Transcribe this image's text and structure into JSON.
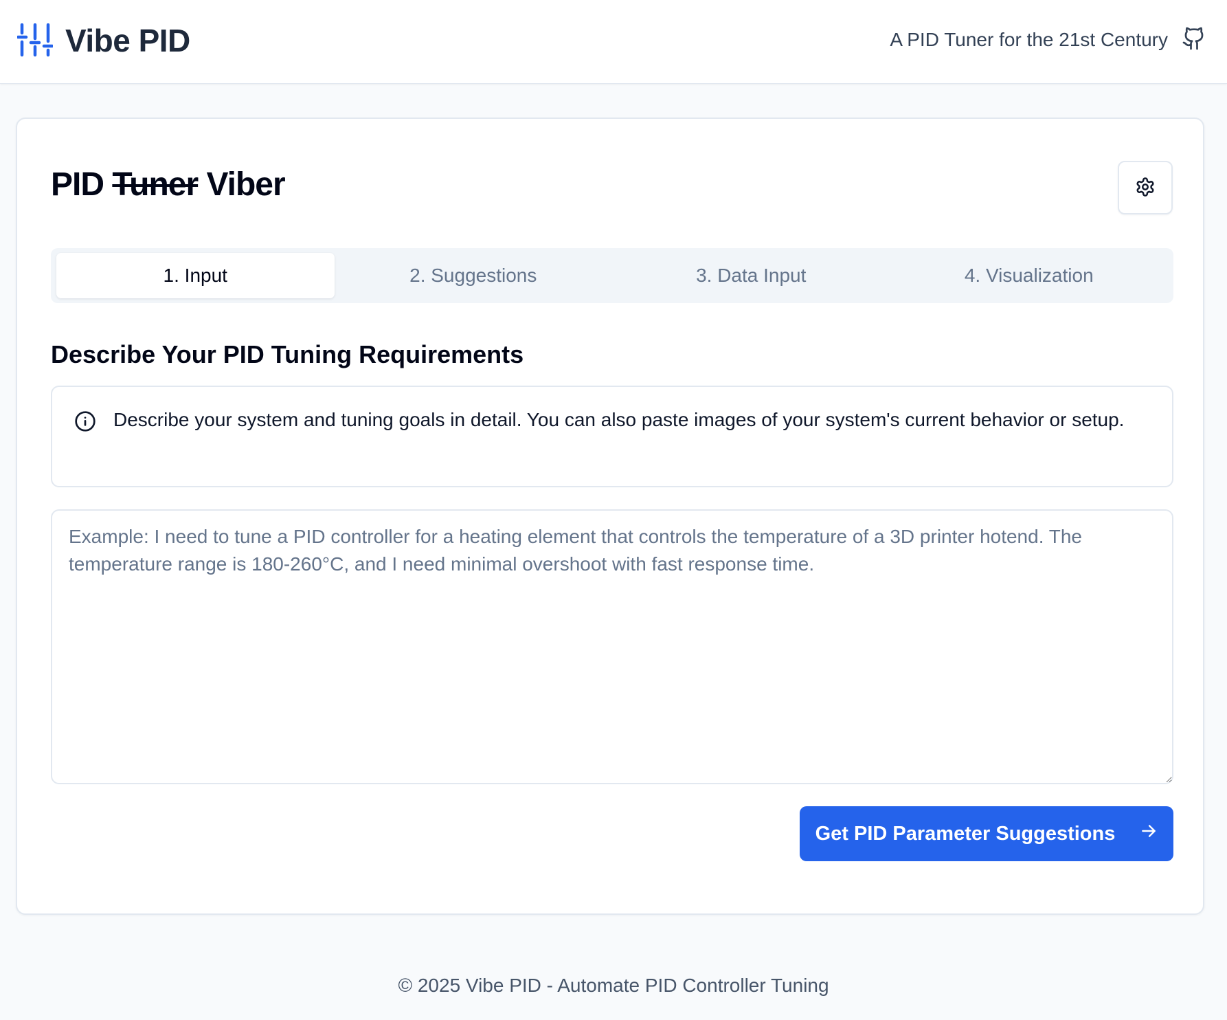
{
  "header": {
    "logo_icon": "sliders-icon",
    "brand": "Vibe PID",
    "tagline": "A PID Tuner for the 21st Century",
    "github_icon": "github-icon"
  },
  "card": {
    "title_prefix": "PID",
    "title_struck": "Tuner",
    "title_suffix": "Viber",
    "settings_icon": "gear-icon"
  },
  "tabs": [
    {
      "label": "1. Input",
      "active": true
    },
    {
      "label": "2. Suggestions",
      "active": false
    },
    {
      "label": "3. Data Input",
      "active": false
    },
    {
      "label": "4. Visualization",
      "active": false
    }
  ],
  "section": {
    "title": "Describe Your PID Tuning Requirements"
  },
  "alert": {
    "icon": "info-icon",
    "text": "Describe your system and tuning goals in detail. You can also paste images of your system's current behavior or setup."
  },
  "requirements": {
    "value": "",
    "placeholder": "Example: I need to tune a PID controller for a heating element that controls the temperature of a 3D printer hotend. The temperature range is 180-260°C, and I need minimal overshoot with fast response time."
  },
  "actions": {
    "submit_label": "Get PID Parameter Suggestions",
    "submit_icon": "arrow-right-icon"
  },
  "footer": {
    "text": "© 2025 Vibe PID - Automate PID Controller Tuning"
  },
  "colors": {
    "accent": "#2563eb",
    "page_bg": "#f8fafc",
    "border": "#e2e8f0",
    "muted_text": "#64748b"
  }
}
